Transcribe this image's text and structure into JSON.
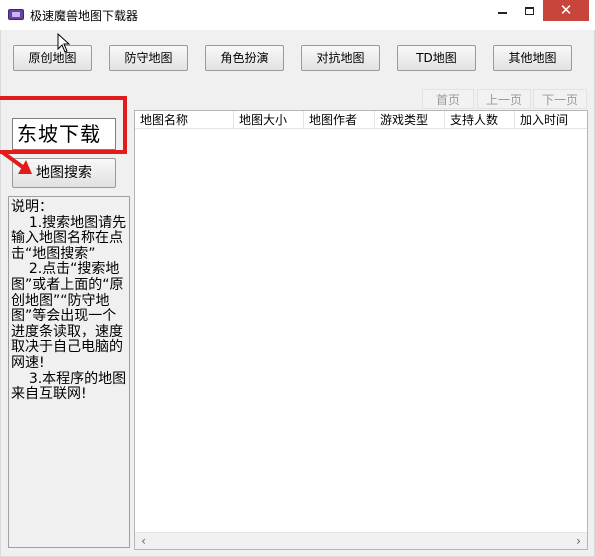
{
  "window": {
    "title": "极速魔兽地图下载器",
    "close_glyph": "✕"
  },
  "categories": [
    {
      "label": "原创地图"
    },
    {
      "label": "防守地图"
    },
    {
      "label": "角色扮演"
    },
    {
      "label": "对抗地图"
    },
    {
      "label": "TD地图"
    },
    {
      "label": "其他地图"
    }
  ],
  "pager": {
    "first": "首页",
    "prev": "上一页",
    "next": "下一页"
  },
  "search": {
    "value": "东坡下载",
    "button_label": "地图搜索"
  },
  "description": "说明：\n    1.搜索地图请先输入地图名称在点击“地图搜索”\n    2.点击“搜索地图”或者上面的“原创地图”“防守地图”等会出现一个进度条读取，速度取决于自己电脑的网速!\n    3.本程序的地图来自互联网!",
  "table": {
    "columns": [
      "地图名称",
      "地图大小",
      "地图作者",
      "游戏类型",
      "支持人数",
      "加入时间"
    ],
    "rows": []
  },
  "icons": {
    "app": "app-icon",
    "minimize": "minimize-icon",
    "maximize": "maximize-icon",
    "close": "close-icon",
    "scroll_left": "chevron-left-icon",
    "scroll_right": "chevron-right-icon"
  },
  "colors": {
    "close_button": "#c7453b",
    "highlight": "#e31b1b",
    "pager_disabled_text": "#9a9a9a"
  }
}
